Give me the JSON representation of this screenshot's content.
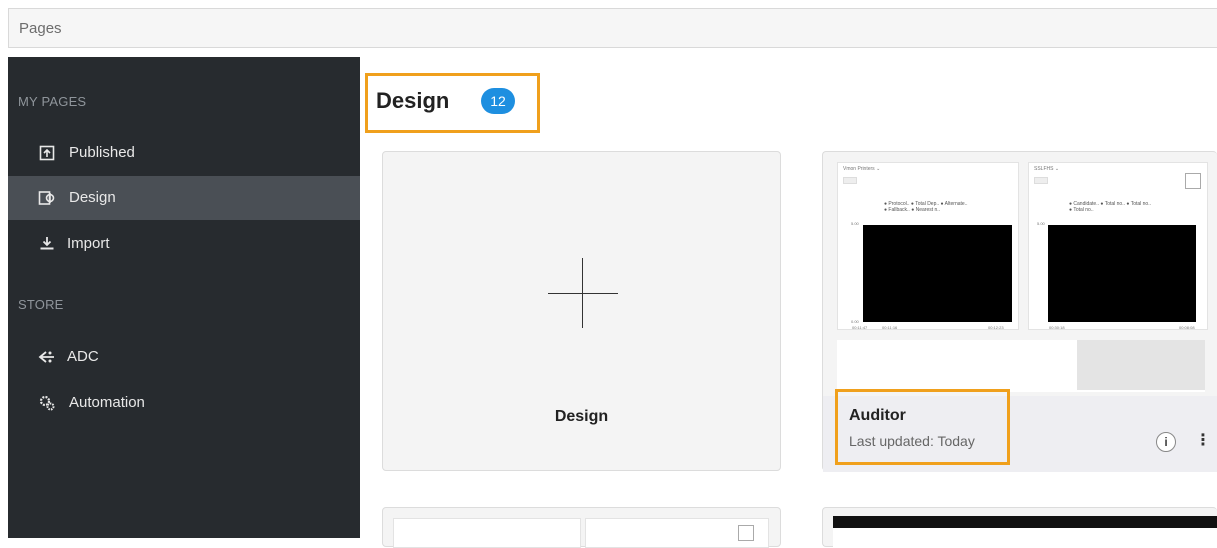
{
  "app": {
    "title": "Pages"
  },
  "sidebar": {
    "my_pages_header": "MY PAGES",
    "store_header": "STORE",
    "items": [
      {
        "label": "Published",
        "icon": "upload-page-icon"
      },
      {
        "label": "Design",
        "icon": "design-icon",
        "active": true
      },
      {
        "label": "Import",
        "icon": "import-icon"
      },
      {
        "label": "ADC",
        "icon": "adc-icon"
      },
      {
        "label": "Automation",
        "icon": "automation-gear-icon"
      }
    ]
  },
  "main": {
    "heading": "Design",
    "count": "12",
    "new_card": {
      "label": "Design"
    },
    "auditor_card": {
      "title": "Auditor",
      "subtitle": "Last updated: Today",
      "thumb1": {
        "title": "Vmon Printers ⌄",
        "tag": "Live",
        "legend1": "● Protocol.. ● Total Dep.. ● Alternate..",
        "legend2": "● Fallback.. ● Nearest n..",
        "y_top": "5.00",
        "y_bottom": "0.00",
        "x1": "00:11:47",
        "x2": "00:11:16",
        "x3": "00:12:23"
      },
      "thumb2": {
        "title": "SSLFHS ⌄",
        "tag": "Live",
        "legend1": "● Candidate.. ● Total no.. ● Total no..",
        "legend2": "● Total no..",
        "y_top": "5.00",
        "x1": "00:30:18",
        "x2": "00:08:08"
      }
    },
    "colors": {
      "accent": "#1e8fe0",
      "highlight": "#f0a01c",
      "sidebar_bg": "#272b2f",
      "active_bg": "#4a4f55"
    }
  }
}
